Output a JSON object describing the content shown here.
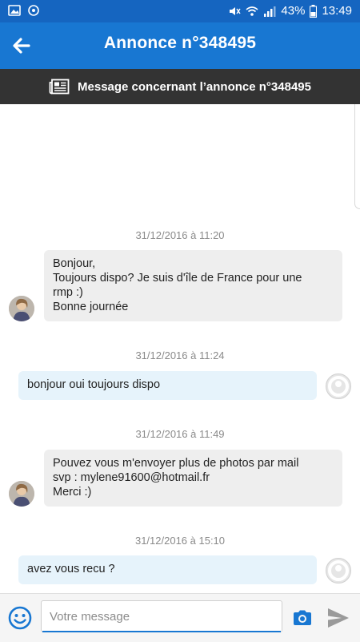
{
  "status_bar": {
    "battery": "43%",
    "time": "13:49"
  },
  "app_bar": {
    "title": "Annonce n°348495"
  },
  "sub_bar": {
    "text": "Message concernant l’annonce n°348495"
  },
  "messages": [
    {
      "timestamp": "31/12/2016 à 11:20",
      "direction": "incoming",
      "lines": [
        "Bonjour,",
        "Toujours dispo? Je suis d'île de France pour une",
        "rmp :)",
        "Bonne journée"
      ]
    },
    {
      "timestamp": "31/12/2016 à 11:24",
      "direction": "outgoing",
      "lines": [
        "bonjour oui toujours dispo"
      ]
    },
    {
      "timestamp": "31/12/2016 à 11:49",
      "direction": "incoming",
      "lines": [
        "Pouvez vous m'envoyer plus de photos par mail",
        "svp : mylene91600@hotmail.fr",
        "Merci :)"
      ]
    },
    {
      "timestamp": "31/12/2016 à 15:10",
      "direction": "outgoing",
      "lines": [
        "avez vous recu ?"
      ]
    }
  ],
  "composer": {
    "placeholder": "Votre message"
  },
  "colors": {
    "status_bar": "#1565c0",
    "app_bar": "#1877d2",
    "sub_bar": "#333333",
    "incoming_bubble": "#eeeeee",
    "outgoing_bubble": "#e6f3fb",
    "accent": "#1877d2"
  },
  "icons": {
    "back": "arrow-left-icon",
    "newspaper": "newspaper-icon",
    "emoji": "smiley-icon",
    "camera": "camera-icon",
    "send": "send-icon"
  }
}
